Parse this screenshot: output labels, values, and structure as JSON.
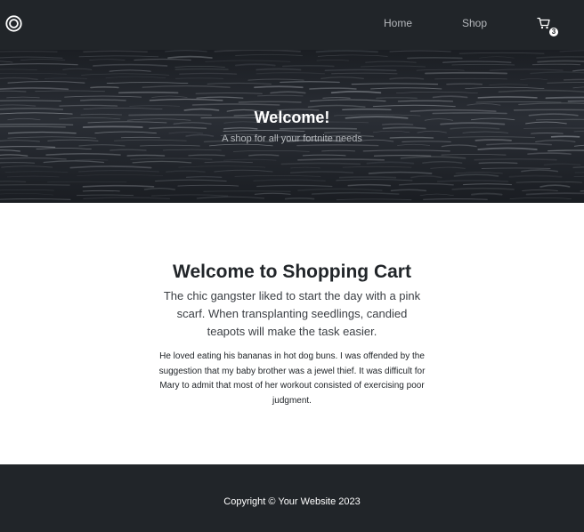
{
  "navbar": {
    "brand_icon": "circle-logo-icon",
    "links": [
      {
        "label": "Home"
      },
      {
        "label": "Shop"
      }
    ],
    "cart": {
      "icon": "cart-icon",
      "count": "3"
    }
  },
  "hero": {
    "title": "Welcome!",
    "subtitle": "A shop for all your fortnite needs"
  },
  "main": {
    "title": "Welcome to Shopping Cart",
    "lead": "The chic gangster liked to start the day with a pink scarf. When transplanting seedlings, candied teapots will make the task easier.",
    "body": "He loved eating his bananas in hot dog buns. I was offended by the suggestion that my baby brother was a jewel thief. It was difficult for Mary to admit that most of her workout consisted of exercising poor judgment."
  },
  "footer": {
    "copyright": "Copyright © Your Website 2023"
  },
  "colors": {
    "navbar_bg": "#212529",
    "nav_link": "#b5b8bc",
    "footer_bg": "#212529",
    "text": "#212529"
  }
}
